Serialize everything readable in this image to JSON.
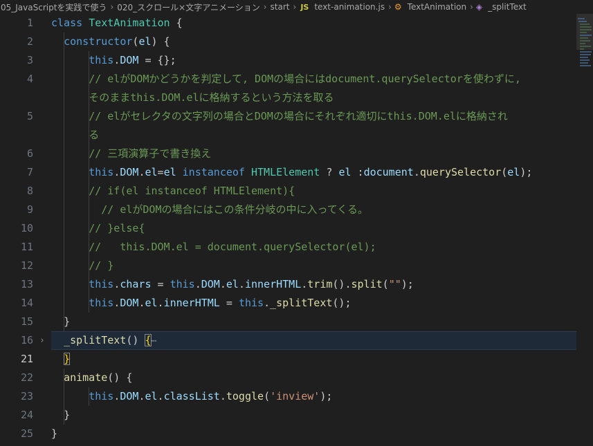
{
  "breadcrumb": {
    "items": [
      "05_JavaScriptを実践で使う",
      "020_スクロール×文字アニメーション",
      "start",
      "text-animation.js",
      "TextAnimation",
      "_splitText"
    ],
    "icons": {
      "file": "js-file-icon",
      "class": "class-icon",
      "method": "method-icon"
    },
    "js_label": "JS"
  },
  "editor": {
    "line_numbers": [
      "1",
      "2",
      "3",
      "4",
      "",
      "5",
      "",
      "6",
      "7",
      "8",
      "9",
      "10",
      "11",
      "12",
      "13",
      "14",
      "15",
      "16",
      "21",
      "22",
      "23",
      "24",
      "25"
    ],
    "active_line": "21",
    "folded_line": "16",
    "fold_ellipsis": "⋯",
    "lines": {
      "l1a": "class ",
      "l1b": "TextAnimation",
      "l1c": " {",
      "l2a": "constructor",
      "l2b": "(",
      "l2c": "el",
      "l2d": ") {",
      "l3a": "this",
      "l3b": ".",
      "l3c": "DOM",
      "l3d": " = {};",
      "l4": "// elがDOMかどうかを判定して, DOMの場合にはdocument.querySelectorを使わずに,",
      "l4w": "そのままthis.DOM.elに格納するという方法を取る",
      "l5": "// elがセレクタの文字列の場合とDOMの場合にそれぞれ適切にthis.DOM.elに格納され",
      "l5w": "る",
      "l6": "// 三項演算子で書き換え",
      "l7a": "this",
      "l7b": ".",
      "l7c": "DOM",
      "l7d": ".",
      "l7e": "el",
      "l7f": "=",
      "l7g": "el",
      "l7h": " instanceof ",
      "l7i": "HTMLElement",
      "l7j": " ? ",
      "l7k": "el",
      "l7l": " :",
      "l7m": "document",
      "l7n": ".",
      "l7o": "querySelector",
      "l7p": "(",
      "l7q": "el",
      "l7r": ");",
      "l8": "// if(el instanceof HTMLElement){",
      "l9": "  // elがDOMの場合にはこの条件分岐の中に入ってくる。",
      "l10": "// }else{",
      "l11": "//   this.DOM.el = document.querySelector(el);",
      "l12": "// }",
      "l13a": "this",
      "l13b": ".",
      "l13c": "chars",
      "l13d": " = ",
      "l13e": "this",
      "l13f": ".",
      "l13g": "DOM",
      "l13h": ".",
      "l13i": "el",
      "l13j": ".",
      "l13k": "innerHTML",
      "l13l": ".",
      "l13m": "trim",
      "l13n": "().",
      "l13o": "split",
      "l13p": "(",
      "l13q": "\"\"",
      "l13r": ");",
      "l14a": "this",
      "l14b": ".",
      "l14c": "DOM",
      "l14d": ".",
      "l14e": "el",
      "l14f": ".",
      "l14g": "innerHTML",
      "l14h": " = ",
      "l14i": "this",
      "l14j": ".",
      "l14k": "_splitText",
      "l14l": "();",
      "l15": "}",
      "l16a": "_splitText",
      "l16b": "() ",
      "l16c": "{",
      "l21": "}",
      "l22a": "animate",
      "l22b": "() {",
      "l23a": "this",
      "l23b": ".",
      "l23c": "DOM",
      "l23d": ".",
      "l23e": "el",
      "l23f": ".",
      "l23g": "classList",
      "l23h": ".",
      "l23i": "toggle",
      "l23j": "(",
      "l23k": "'inview'",
      "l23l": ");",
      "l24": "}",
      "l25": "}"
    }
  },
  "colors": {
    "background": "#1f1f1f",
    "keyword": "#569cd6",
    "class": "#4ec9b0",
    "function": "#dcdcaa",
    "property": "#9cdcfe",
    "comment": "#6a9955",
    "string": "#ce9178",
    "current_line": "#1e2a38"
  }
}
